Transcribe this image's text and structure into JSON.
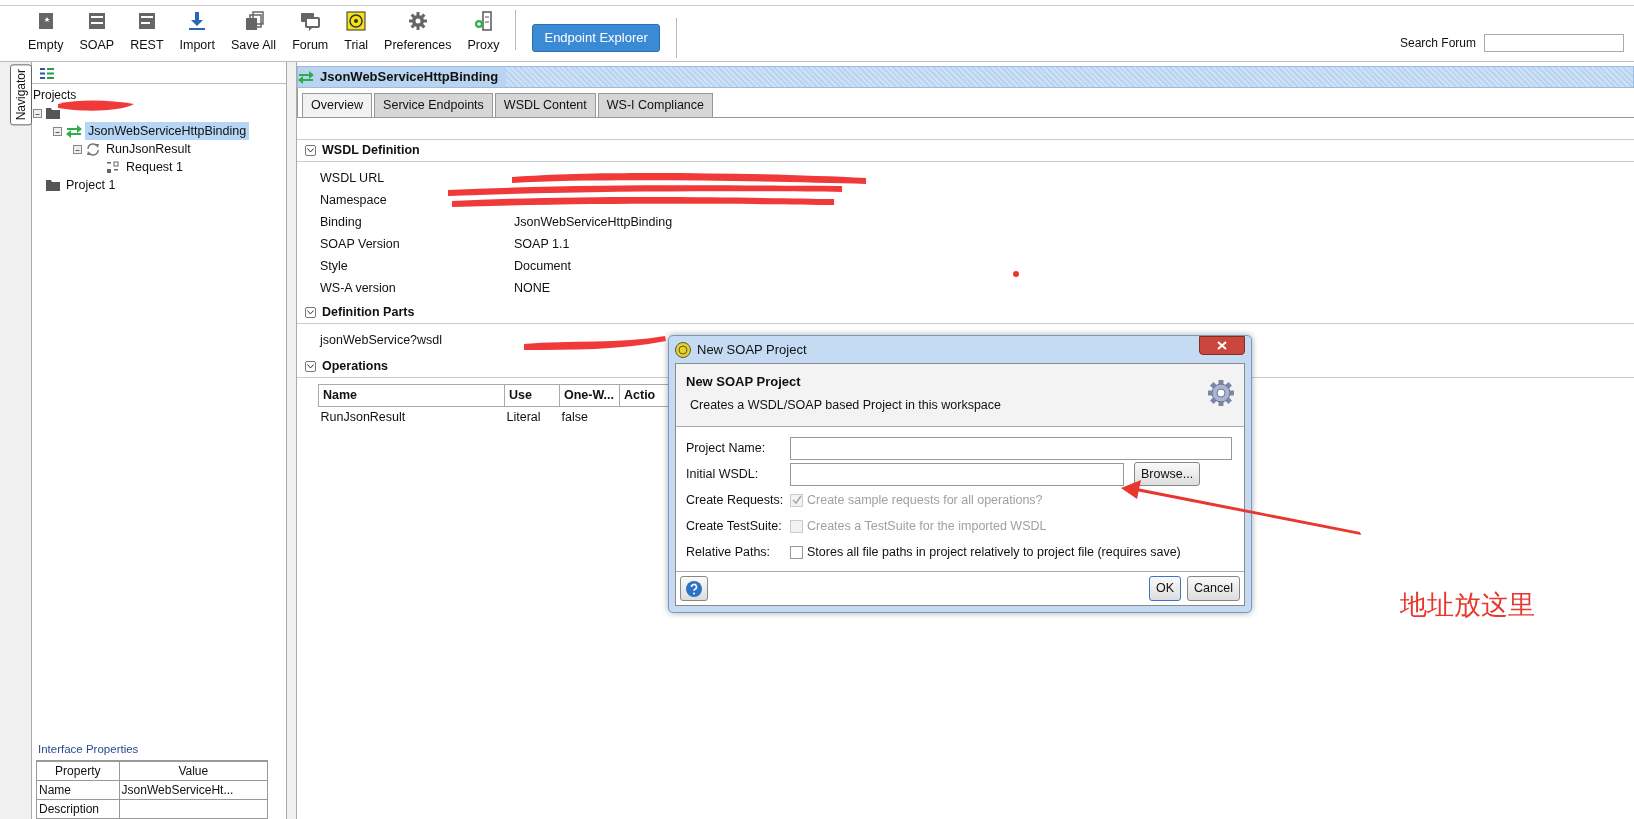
{
  "toolbar": {
    "buttons": [
      {
        "label": "Empty",
        "kind": "empty"
      },
      {
        "label": "SOAP",
        "kind": "soap"
      },
      {
        "label": "REST",
        "kind": "rest"
      },
      {
        "label": "Import",
        "kind": "import"
      },
      {
        "label": "Save All",
        "kind": "saveall"
      },
      {
        "label": "Forum",
        "kind": "forum"
      },
      {
        "label": "Trial",
        "kind": "trial"
      },
      {
        "label": "Preferences",
        "kind": "gear"
      },
      {
        "label": "Proxy",
        "kind": "proxy"
      }
    ],
    "endpoint_button": "Endpoint Explorer",
    "search_label": "Search Forum"
  },
  "navigator": {
    "tab": "Navigator",
    "tree_title": "Projects",
    "tree": [
      {
        "kind": "project",
        "selected": false,
        "expanded": true,
        "children": [
          {
            "kind": "interface",
            "label": "JsonWebServiceHttpBinding",
            "selected": true,
            "expanded": true,
            "children": [
              {
                "kind": "operation",
                "label": "RunJsonResult",
                "selected": false,
                "expanded": true,
                "children": [
                  {
                    "kind": "request",
                    "label": "Request 1",
                    "selected": false
                  }
                ]
              }
            ]
          }
        ]
      },
      {
        "kind": "project",
        "label": "Project 1",
        "selected": false
      }
    ]
  },
  "properties": {
    "title": "Interface Properties",
    "columns": [
      "Property",
      "Value"
    ],
    "rows": [
      {
        "property": "Name",
        "value": "JsonWebServiceHt..."
      },
      {
        "property": "Description"
      }
    ]
  },
  "main": {
    "title": "JsonWebServiceHttpBinding",
    "tabs": [
      {
        "label": "Overview",
        "selected": true
      },
      {
        "label": "Service Endpoints",
        "selected": false
      },
      {
        "label": "WSDL Content",
        "selected": false
      },
      {
        "label": "WS-I Compliance",
        "selected": false
      }
    ],
    "wsdl_definition": {
      "title": "WSDL Definition",
      "rows": [
        {
          "label": "WSDL URL"
        },
        {
          "label": "Namespace"
        },
        {
          "label": "Binding",
          "value": "JsonWebServiceHttpBinding"
        },
        {
          "label": "SOAP Version",
          "value": "SOAP 1.1"
        },
        {
          "label": "Style",
          "value": "Document"
        },
        {
          "label": "WS-A version",
          "value": "NONE"
        }
      ]
    },
    "definition_parts": {
      "title": "Definition Parts",
      "rows": [
        {
          "label": "jsonWebService?wsdl"
        }
      ]
    },
    "operations": {
      "title": "Operations",
      "columns": [
        "Name",
        "Use",
        "One-W...",
        "Actio"
      ],
      "rows": [
        [
          "RunJsonResult",
          "Literal",
          "false"
        ]
      ]
    }
  },
  "dialog": {
    "title": "New SOAP Project",
    "heading": "New SOAP Project",
    "description": "Creates a WSDL/SOAP based Project in this workspace",
    "fields": [
      {
        "kind": "text",
        "label": "Project Name:"
      },
      {
        "kind": "text",
        "label": "Initial WSDL:",
        "button": "Browse..."
      },
      {
        "kind": "checkbox",
        "label": "Create Requests:",
        "text": "Create sample requests for all operations?",
        "checked": true,
        "disabled": true
      },
      {
        "kind": "checkbox",
        "label": "Create TestSuite:",
        "text": "Creates a TestSuite for the imported WSDL",
        "checked": false,
        "disabled": true
      },
      {
        "kind": "checkbox",
        "label": "Relative Paths:",
        "text": "Stores all file paths in project relatively to project file (requires save)",
        "checked": false,
        "disabled": false
      }
    ],
    "buttons": [
      "OK",
      "Cancel"
    ]
  },
  "annotation": {
    "text": "地址放这里"
  }
}
